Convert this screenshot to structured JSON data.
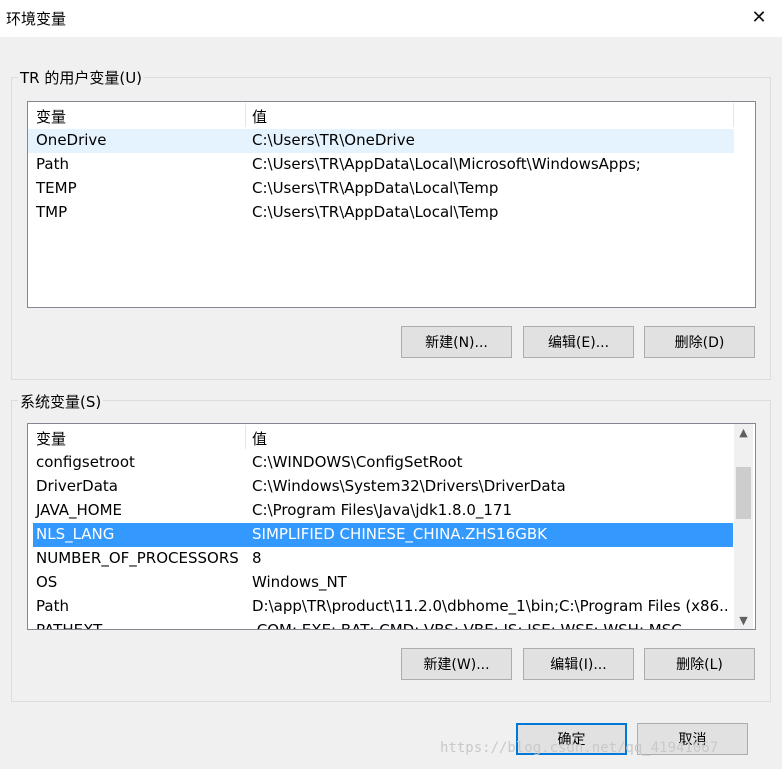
{
  "window": {
    "title": "环境变量",
    "close_icon": "close-icon"
  },
  "user_vars": {
    "group_label": "TR 的用户变量(U)",
    "columns": [
      "变量",
      "值"
    ],
    "rows": [
      [
        "OneDrive",
        "C:\\Users\\TR\\OneDrive"
      ],
      [
        "Path",
        "C:\\Users\\TR\\AppData\\Local\\Microsoft\\WindowsApps;"
      ],
      [
        "TEMP",
        "C:\\Users\\TR\\AppData\\Local\\Temp"
      ],
      [
        "TMP",
        "C:\\Users\\TR\\AppData\\Local\\Temp"
      ]
    ],
    "highlighted_row": "OneDrive",
    "buttons": {
      "new": "新建(N)...",
      "edit": "编辑(E)...",
      "delete": "删除(D)"
    }
  },
  "system_vars": {
    "group_label": "系统变量(S)",
    "columns": [
      "变量",
      "值"
    ],
    "rows": [
      [
        "configsetroot",
        "C:\\WINDOWS\\ConfigSetRoot"
      ],
      [
        "DriverData",
        "C:\\Windows\\System32\\Drivers\\DriverData"
      ],
      [
        "JAVA_HOME",
        "C:\\Program Files\\Java\\jdk1.8.0_171"
      ],
      [
        "NLS_LANG",
        "SIMPLIFIED CHINESE_CHINA.ZHS16GBK"
      ],
      [
        "NUMBER_OF_PROCESSORS",
        "8"
      ],
      [
        "OS",
        "Windows_NT"
      ],
      [
        "Path",
        "D:\\app\\TR\\product\\11.2.0\\dbhome_1\\bin;C:\\Program Files (x86..."
      ],
      [
        "PATHEXT",
        ".COM;.EXE;.BAT;.CMD;.VBS;.VBE;.JS;.JSE;.WSF;.WSH;.MSC"
      ]
    ],
    "selected_row": "NLS_LANG",
    "scroll_up_icon": "chevron-up-icon",
    "scroll_down_icon": "chevron-down-icon",
    "buttons": {
      "new": "新建(W)...",
      "edit": "编辑(I)...",
      "delete": "删除(L)"
    }
  },
  "footer": {
    "ok": "确定",
    "cancel": "取消"
  },
  "watermark": "https://blog.csdn.net/qq_41941067",
  "colors": {
    "selection": "#3399ff",
    "default_button_border": "#0078d7",
    "hover_row": "#e5f3ff"
  }
}
